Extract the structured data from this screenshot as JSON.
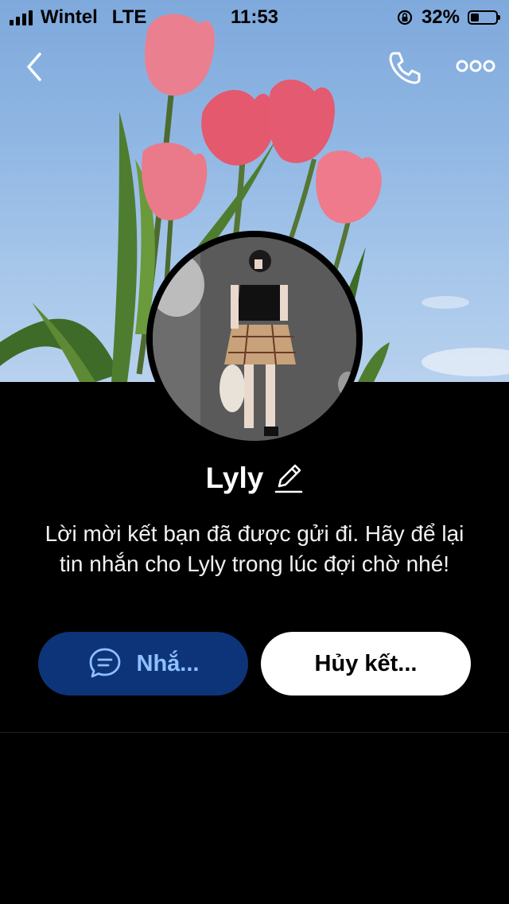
{
  "status_bar": {
    "carrier": "Wintel",
    "network": "LTE",
    "time": "11:53",
    "battery_percent": "32%",
    "battery_level": 0.32
  },
  "profile": {
    "name": "Lyly",
    "description": "Lời mời kết bạn đã được gửi đi. Hãy để lại tin nhắn cho Lyly trong lúc đợi chờ nhé!"
  },
  "actions": {
    "message_label": "Nhắ...",
    "cancel_label": "Hủy kết..."
  },
  "icons": {
    "back": "chevron-left-icon",
    "call": "phone-icon",
    "more": "more-dots-icon",
    "edit": "pencil-icon",
    "message": "chat-bubble-icon"
  },
  "colors": {
    "message_button_bg": "#0d3478",
    "message_button_text": "#8ec0ff",
    "cancel_button_bg": "#ffffff",
    "background": "#000000"
  }
}
